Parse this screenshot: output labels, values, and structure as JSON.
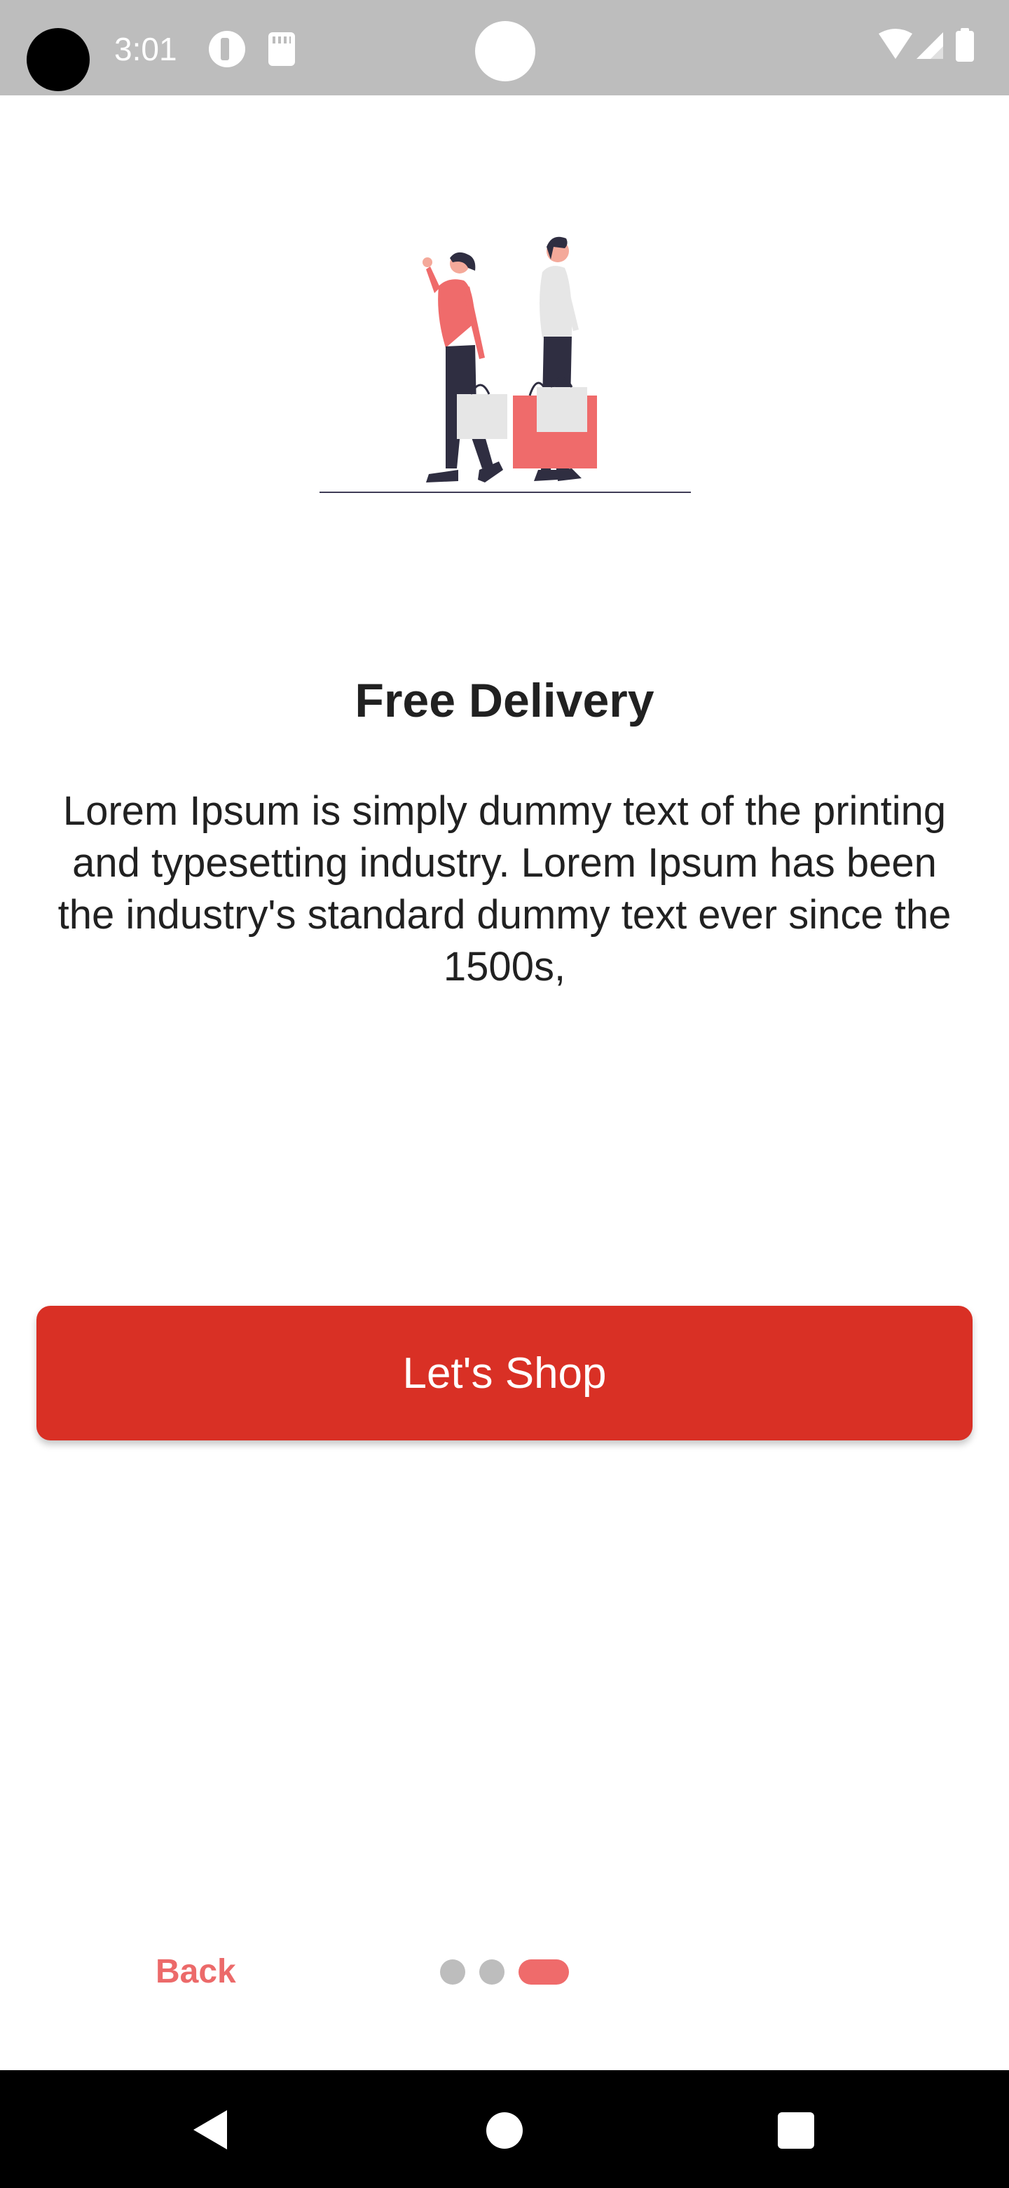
{
  "status_bar": {
    "time": "3:01",
    "icons": [
      "notification-app-icon",
      "sd-card-icon",
      "wifi-icon",
      "cellular-signal-icon",
      "battery-icon"
    ]
  },
  "illustration": {
    "icon": "shopping-people-illustration",
    "colors": {
      "accent": "#ef6b6b",
      "dark": "#2f2e41",
      "light": "#e6e6e6",
      "ground": "#3f3d56"
    }
  },
  "content": {
    "title": "Free Delivery",
    "body": "Lorem Ipsum is simply dummy text of the printing and typesetting industry. Lorem Ipsum has been the industry's standard dummy text ever since the 1500s,"
  },
  "cta": {
    "label": "Let's Shop",
    "color": "#d93025"
  },
  "onboarding_nav": {
    "back_label": "Back",
    "page_count": 3,
    "current_page": 3,
    "active_color": "#ef6b6b",
    "inactive_color": "#bdbdbd"
  },
  "system_nav": {
    "icons": [
      "back-triangle-icon",
      "home-circle-icon",
      "recents-square-icon"
    ]
  }
}
